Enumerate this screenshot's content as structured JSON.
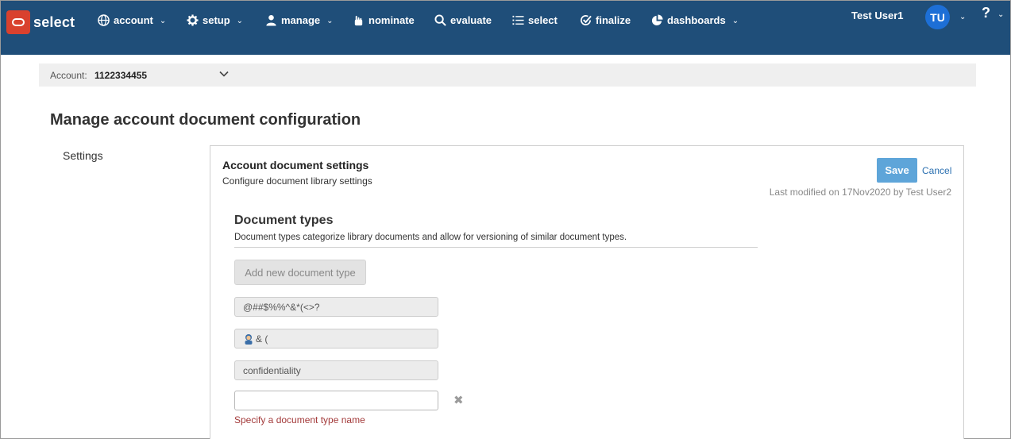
{
  "brand": {
    "name": "select",
    "color": "#d9412e"
  },
  "nav": [
    {
      "label": "account",
      "icon": "globe-icon",
      "dropdown": true
    },
    {
      "label": "setup",
      "icon": "gear-icon",
      "dropdown": true
    },
    {
      "label": "manage",
      "icon": "user-icon",
      "dropdown": true
    },
    {
      "label": "nominate",
      "icon": "hand-icon",
      "dropdown": false
    },
    {
      "label": "evaluate",
      "icon": "search-icon",
      "dropdown": false
    },
    {
      "label": "select",
      "icon": "list-icon",
      "dropdown": false
    },
    {
      "label": "finalize",
      "icon": "check-circle-icon",
      "dropdown": false
    },
    {
      "label": "dashboards",
      "icon": "pie-chart-icon",
      "dropdown": true
    }
  ],
  "user": {
    "name": "Test User1",
    "initials": "TU",
    "help": "?"
  },
  "account_bar": {
    "label": "Account:",
    "value": "1122334455"
  },
  "page": {
    "title": "Manage account document configuration",
    "side_item": "Settings"
  },
  "panel": {
    "title": "Account document settings",
    "subtitle": "Configure document library settings",
    "save_label": "Save",
    "cancel_label": "Cancel",
    "last_modified": "Last modified on 17Nov2020 by Test User2"
  },
  "doc_types": {
    "title": "Document types",
    "description": "Document types categorize library documents and allow for versioning of similar document types.",
    "add_label": "Add new document type",
    "items": [
      "@##$%%^&*(<>?",
      "& (",
      "confidentiality"
    ],
    "new_value": "",
    "error": "Specify a document type name"
  },
  "colors": {
    "nav_bg": "#1f4e79",
    "save_bg": "#5ea5d9",
    "avatar_bg": "#1d6fd6",
    "error": "#a33a3a"
  }
}
